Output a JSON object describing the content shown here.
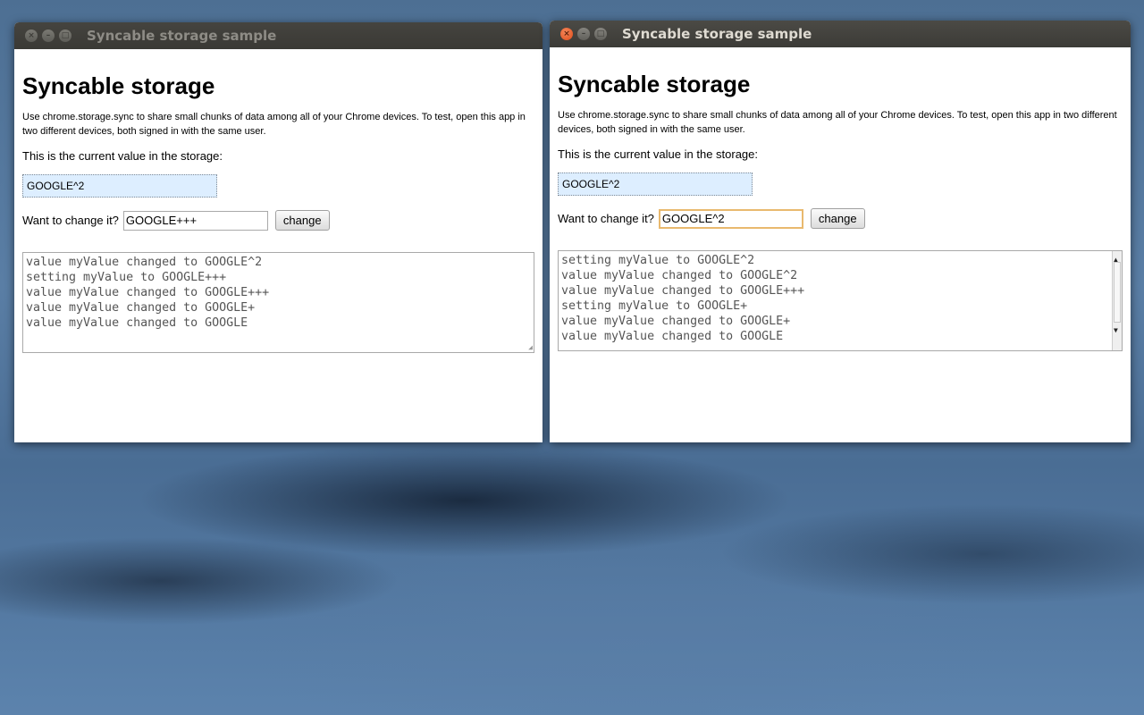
{
  "windows": [
    {
      "title": "Syncable storage sample",
      "heading": "Syncable storage",
      "description": "Use chrome.storage.sync to share small chunks of data among all of your Chrome devices. To test, open this app in two different devices, both signed in with the same user.",
      "current_label": "This is the current value in the storage:",
      "current_value": "GOOGLE^2",
      "change_label": "Want to change it?",
      "change_input_value": "GOOGLE+++",
      "change_button": "change",
      "log": [
        "value myValue changed to GOOGLE^2",
        "setting myValue to GOOGLE+++",
        "value myValue changed to GOOGLE+++",
        "value myValue changed to GOOGLE+",
        "value myValue changed to GOOGLE"
      ]
    },
    {
      "title": "Syncable storage sample",
      "heading": "Syncable storage",
      "description": "Use chrome.storage.sync to share small chunks of data among all of your Chrome devices. To test, open this app in two different devices, both signed in with the same user.",
      "current_label": "This is the current value in the storage:",
      "current_value": "GOOGLE^2",
      "change_label": "Want to change it?",
      "change_input_value": "GOOGLE^2",
      "change_button": "change",
      "log": [
        "setting myValue to GOOGLE^2",
        "value myValue changed to GOOGLE^2",
        "value myValue changed to GOOGLE+++",
        "setting myValue to GOOGLE+",
        "value myValue changed to GOOGLE+",
        "value myValue changed to GOOGLE"
      ]
    }
  ],
  "icons": {
    "close": "close-icon",
    "minimize": "minimize-icon",
    "maximize": "maximize-icon"
  },
  "colors": {
    "close_button": "#df4c19",
    "current_value_bg": "#ddeeff",
    "titlebar": "#3c3b37"
  }
}
